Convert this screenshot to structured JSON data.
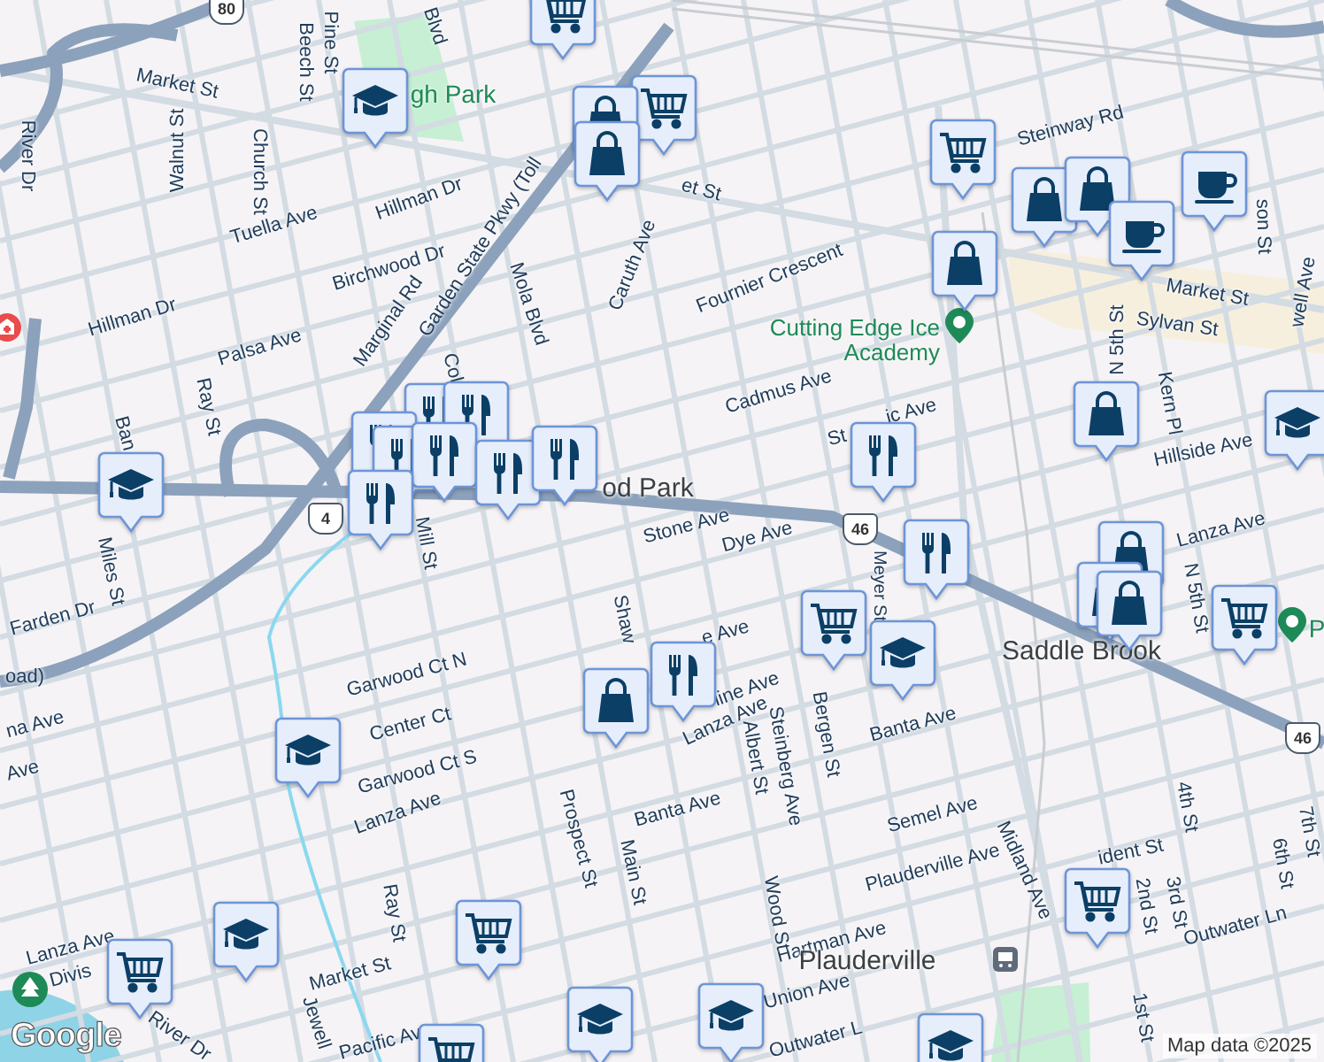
{
  "map": {
    "labels": [
      {
        "kind": "street",
        "text": "Market St"
      },
      {
        "kind": "street",
        "text": "Beech St"
      },
      {
        "kind": "street",
        "text": "Pine St"
      },
      {
        "kind": "street",
        "text": "Walnut St"
      },
      {
        "kind": "street",
        "text": "Church St"
      },
      {
        "kind": "street",
        "text": "River Dr"
      },
      {
        "kind": "street",
        "text": "Tuella Ave"
      },
      {
        "kind": "street",
        "text": "Hillman Dr"
      },
      {
        "kind": "street",
        "text": "Birchwood Dr"
      },
      {
        "kind": "street",
        "text": "Hillman Dr"
      },
      {
        "kind": "street",
        "text": "Palsa Ave"
      },
      {
        "kind": "street",
        "text": "Marginal Rd"
      },
      {
        "kind": "street",
        "text": "Garden State Pkwy (Toll"
      },
      {
        "kind": "street",
        "text": "Mola Blvd"
      },
      {
        "kind": "street",
        "text": "Blvd"
      },
      {
        "kind": "street",
        "text": "et St"
      },
      {
        "kind": "street",
        "text": "Caruth Ave"
      },
      {
        "kind": "street",
        "text": "Fournier Crescent"
      },
      {
        "kind": "street",
        "text": "Cadmus Ave"
      },
      {
        "kind": "street",
        "text": "Steinway Rd"
      },
      {
        "kind": "street",
        "text": "Market St"
      },
      {
        "kind": "street",
        "text": "Sylvan St"
      },
      {
        "kind": "street",
        "text": "N 5th St"
      },
      {
        "kind": "street",
        "text": "Kern Pl"
      },
      {
        "kind": "street",
        "text": "Hillside Ave"
      },
      {
        "kind": "street",
        "text": "well Ave"
      },
      {
        "kind": "street",
        "text": "son St"
      },
      {
        "kind": "street",
        "text": "St"
      },
      {
        "kind": "street",
        "text": "ic Ave"
      },
      {
        "kind": "street",
        "text": "Stone Ave"
      },
      {
        "kind": "street",
        "text": "Dye Ave"
      },
      {
        "kind": "street",
        "text": "Meyer St"
      },
      {
        "kind": "street",
        "text": "Lanza Ave"
      },
      {
        "kind": "street",
        "text": "Shaw"
      },
      {
        "kind": "street",
        "text": "e Ave"
      },
      {
        "kind": "street",
        "text": "line Ave"
      },
      {
        "kind": "street",
        "text": "Lanza Ave"
      },
      {
        "kind": "street",
        "text": "Albert St"
      },
      {
        "kind": "street",
        "text": "Steinberg Ave"
      },
      {
        "kind": "street",
        "text": "Bergen St"
      },
      {
        "kind": "street",
        "text": "Banta Ave"
      },
      {
        "kind": "street",
        "text": "Banta Ave"
      },
      {
        "kind": "street",
        "text": "Semel Ave"
      },
      {
        "kind": "street",
        "text": "Midland Ave"
      },
      {
        "kind": "street",
        "text": "Plauderville Ave"
      },
      {
        "kind": "street",
        "text": "Hartman Ave"
      },
      {
        "kind": "street",
        "text": "Union Ave"
      },
      {
        "kind": "street",
        "text": "Outwater L"
      },
      {
        "kind": "street",
        "text": "Wood St"
      },
      {
        "kind": "street",
        "text": "ident St"
      },
      {
        "kind": "street",
        "text": "2nd St"
      },
      {
        "kind": "street",
        "text": "3rd St"
      },
      {
        "kind": "street",
        "text": "4th St"
      },
      {
        "kind": "street",
        "text": "6th St"
      },
      {
        "kind": "street",
        "text": "7th St"
      },
      {
        "kind": "street",
        "text": "1st St"
      },
      {
        "kind": "street",
        "text": "Outwater Ln"
      },
      {
        "kind": "street",
        "text": "N 5th St"
      },
      {
        "kind": "street",
        "text": "Lanza Ave"
      },
      {
        "kind": "street",
        "text": "Lanza Ave"
      },
      {
        "kind": "street",
        "text": "Garwood Ct N"
      },
      {
        "kind": "street",
        "text": "Center Ct"
      },
      {
        "kind": "street",
        "text": "Garwood Ct S"
      },
      {
        "kind": "street",
        "text": "Ray St"
      },
      {
        "kind": "street",
        "text": "Prospect St"
      },
      {
        "kind": "street",
        "text": "Main St"
      },
      {
        "kind": "street",
        "text": "Market St"
      },
      {
        "kind": "street",
        "text": "Pacific Av"
      },
      {
        "kind": "street",
        "text": "Jewell"
      },
      {
        "kind": "street",
        "text": "Divis"
      },
      {
        "kind": "street",
        "text": "River Dr"
      },
      {
        "kind": "street",
        "text": "Miles St"
      },
      {
        "kind": "street",
        "text": "Farden Dr"
      },
      {
        "kind": "street",
        "text": "oad)"
      },
      {
        "kind": "street",
        "text": "na Ave"
      },
      {
        "kind": "street",
        "text": "Ave"
      },
      {
        "kind": "street",
        "text": "Ban"
      },
      {
        "kind": "street",
        "text": "Ray St"
      },
      {
        "kind": "street",
        "text": "Mill St"
      },
      {
        "kind": "street",
        "text": "Col"
      },
      {
        "kind": "poi",
        "text": "gh Park"
      },
      {
        "kind": "poi",
        "text": "Cutting Edge Ice Academy"
      },
      {
        "kind": "place",
        "text": "od Park"
      },
      {
        "kind": "place",
        "text": "Saddle Brook"
      },
      {
        "kind": "place",
        "text": "Plauderville"
      },
      {
        "kind": "poi",
        "text": "P"
      }
    ],
    "shields": [
      {
        "text": "80"
      },
      {
        "text": "4"
      },
      {
        "text": "46"
      },
      {
        "text": "46"
      }
    ],
    "markers": [
      {
        "kind": "grocery"
      },
      {
        "kind": "school"
      },
      {
        "kind": "grocery"
      },
      {
        "kind": "shopping"
      },
      {
        "kind": "shopping"
      },
      {
        "kind": "grocery"
      },
      {
        "kind": "shopping"
      },
      {
        "kind": "shopping"
      },
      {
        "kind": "cafe"
      },
      {
        "kind": "cafe"
      },
      {
        "kind": "shopping"
      },
      {
        "kind": "shopping"
      },
      {
        "kind": "school"
      },
      {
        "kind": "restaurant"
      },
      {
        "kind": "school"
      },
      {
        "kind": "restaurant"
      },
      {
        "kind": "restaurant"
      },
      {
        "kind": "restaurant"
      },
      {
        "kind": "restaurant"
      },
      {
        "kind": "restaurant"
      },
      {
        "kind": "restaurant"
      },
      {
        "kind": "restaurant"
      },
      {
        "kind": "restaurant"
      },
      {
        "kind": "restaurant"
      },
      {
        "kind": "shopping"
      },
      {
        "kind": "shopping"
      },
      {
        "kind": "shopping"
      },
      {
        "kind": "grocery"
      },
      {
        "kind": "grocery"
      },
      {
        "kind": "school"
      },
      {
        "kind": "restaurant"
      },
      {
        "kind": "shopping"
      },
      {
        "kind": "school"
      },
      {
        "kind": "school"
      },
      {
        "kind": "grocery"
      },
      {
        "kind": "grocery"
      },
      {
        "kind": "grocery"
      },
      {
        "kind": "school"
      },
      {
        "kind": "school"
      },
      {
        "kind": "school"
      },
      {
        "kind": "grocery"
      }
    ],
    "logo": "Google",
    "attribution": "Map data ©2025"
  }
}
